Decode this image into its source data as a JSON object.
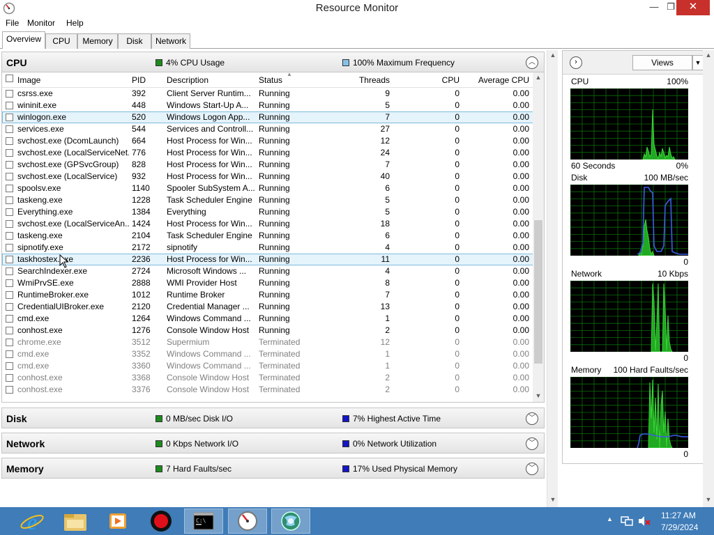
{
  "window": {
    "title": "Resource Monitor",
    "min_glyph": "—",
    "max_glyph": "❐",
    "close_glyph": "✕"
  },
  "menu": [
    "File",
    "Monitor",
    "Help"
  ],
  "tabs": [
    "Overview",
    "CPU",
    "Memory",
    "Disk",
    "Network"
  ],
  "active_tab": "Overview",
  "cpu_section": {
    "title": "CPU",
    "stat1": "4% CPU Usage",
    "stat1_color": "#1e8a1e",
    "stat2": "100% Maximum Frequency",
    "stat2_color": "#86c1ea",
    "columns": [
      "Image",
      "PID",
      "Description",
      "Status",
      "Threads",
      "CPU",
      "Average CPU"
    ],
    "rows": [
      {
        "image": "csrss.exe",
        "pid": "392",
        "desc": "Client Server Runtim...",
        "status": "Running",
        "threads": "9",
        "cpu": "0",
        "avg": "0.00"
      },
      {
        "image": "wininit.exe",
        "pid": "448",
        "desc": "Windows Start-Up A...",
        "status": "Running",
        "threads": "5",
        "cpu": "0",
        "avg": "0.00"
      },
      {
        "image": "winlogon.exe",
        "pid": "520",
        "desc": "Windows Logon App...",
        "status": "Running",
        "threads": "7",
        "cpu": "0",
        "avg": "0.00",
        "selected": true
      },
      {
        "image": "services.exe",
        "pid": "544",
        "desc": "Services and Controll...",
        "status": "Running",
        "threads": "27",
        "cpu": "0",
        "avg": "0.00"
      },
      {
        "image": "svchost.exe (DcomLaunch)",
        "pid": "664",
        "desc": "Host Process for Win...",
        "status": "Running",
        "threads": "12",
        "cpu": "0",
        "avg": "0.00"
      },
      {
        "image": "svchost.exe (LocalServiceNet...",
        "pid": "776",
        "desc": "Host Process for Win...",
        "status": "Running",
        "threads": "24",
        "cpu": "0",
        "avg": "0.00"
      },
      {
        "image": "svchost.exe (GPSvcGroup)",
        "pid": "828",
        "desc": "Host Process for Win...",
        "status": "Running",
        "threads": "7",
        "cpu": "0",
        "avg": "0.00"
      },
      {
        "image": "svchost.exe (LocalService)",
        "pid": "932",
        "desc": "Host Process for Win...",
        "status": "Running",
        "threads": "40",
        "cpu": "0",
        "avg": "0.00"
      },
      {
        "image": "spoolsv.exe",
        "pid": "1140",
        "desc": "Spooler SubSystem A...",
        "status": "Running",
        "threads": "6",
        "cpu": "0",
        "avg": "0.00"
      },
      {
        "image": "taskeng.exe",
        "pid": "1228",
        "desc": "Task Scheduler Engine",
        "status": "Running",
        "threads": "5",
        "cpu": "0",
        "avg": "0.00"
      },
      {
        "image": "Everything.exe",
        "pid": "1384",
        "desc": "Everything",
        "status": "Running",
        "threads": "5",
        "cpu": "0",
        "avg": "0.00"
      },
      {
        "image": "svchost.exe (LocalServiceAn...",
        "pid": "1424",
        "desc": "Host Process for Win...",
        "status": "Running",
        "threads": "18",
        "cpu": "0",
        "avg": "0.00"
      },
      {
        "image": "taskeng.exe",
        "pid": "2104",
        "desc": "Task Scheduler Engine",
        "status": "Running",
        "threads": "6",
        "cpu": "0",
        "avg": "0.00"
      },
      {
        "image": "sipnotify.exe",
        "pid": "2172",
        "desc": "sipnotify",
        "status": "Running",
        "threads": "4",
        "cpu": "0",
        "avg": "0.00"
      },
      {
        "image": "taskhostex.exe",
        "pid": "2236",
        "desc": "Host Process for Win...",
        "status": "Running",
        "threads": "11",
        "cpu": "0",
        "avg": "0.00",
        "hover": true
      },
      {
        "image": "SearchIndexer.exe",
        "pid": "2724",
        "desc": "Microsoft Windows ...",
        "status": "Running",
        "threads": "4",
        "cpu": "0",
        "avg": "0.00"
      },
      {
        "image": "WmiPrvSE.exe",
        "pid": "2888",
        "desc": "WMI Provider Host",
        "status": "Running",
        "threads": "8",
        "cpu": "0",
        "avg": "0.00"
      },
      {
        "image": "RuntimeBroker.exe",
        "pid": "1012",
        "desc": "Runtime Broker",
        "status": "Running",
        "threads": "7",
        "cpu": "0",
        "avg": "0.00"
      },
      {
        "image": "CredentialUIBroker.exe",
        "pid": "2120",
        "desc": "Credential Manager ...",
        "status": "Running",
        "threads": "13",
        "cpu": "0",
        "avg": "0.00"
      },
      {
        "image": "cmd.exe",
        "pid": "1264",
        "desc": "Windows Command ...",
        "status": "Running",
        "threads": "1",
        "cpu": "0",
        "avg": "0.00"
      },
      {
        "image": "conhost.exe",
        "pid": "1276",
        "desc": "Console Window Host",
        "status": "Running",
        "threads": "2",
        "cpu": "0",
        "avg": "0.00"
      },
      {
        "image": "chrome.exe",
        "pid": "3512",
        "desc": "Supermium",
        "status": "Terminated",
        "threads": "12",
        "cpu": "0",
        "avg": "0.00"
      },
      {
        "image": "cmd.exe",
        "pid": "3352",
        "desc": "Windows Command ...",
        "status": "Terminated",
        "threads": "1",
        "cpu": "0",
        "avg": "0.00"
      },
      {
        "image": "cmd.exe",
        "pid": "3360",
        "desc": "Windows Command ...",
        "status": "Terminated",
        "threads": "1",
        "cpu": "0",
        "avg": "0.00"
      },
      {
        "image": "conhost.exe",
        "pid": "3368",
        "desc": "Console Window Host",
        "status": "Terminated",
        "threads": "2",
        "cpu": "0",
        "avg": "0.00"
      },
      {
        "image": "conhost.exe",
        "pid": "3376",
        "desc": "Console Window Host",
        "status": "Terminated",
        "threads": "2",
        "cpu": "0",
        "avg": "0.00"
      }
    ]
  },
  "collapsed_sections": [
    {
      "key": "disk",
      "title": "Disk",
      "stat1": "0 MB/sec Disk I/O",
      "stat2": "7% Highest Active Time"
    },
    {
      "key": "network",
      "title": "Network",
      "stat1": "0 Kbps Network I/O",
      "stat2": "0% Network Utilization"
    },
    {
      "key": "memory",
      "title": "Memory",
      "stat1": "7 Hard Faults/sec",
      "stat2": "17% Used Physical Memory"
    }
  ],
  "collapsed_stat1_color": "#1e8a1e",
  "collapsed_stat2_color": "#1414c8",
  "right_panel": {
    "views_label": "Views",
    "graphs": [
      {
        "name": "CPU",
        "max": "100%",
        "bottom_left": "60 Seconds",
        "bottom_right": "0%"
      },
      {
        "name": "Disk",
        "max": "100 MB/sec",
        "bottom_left": "",
        "bottom_right": "0"
      },
      {
        "name": "Network",
        "max": "10 Kbps",
        "bottom_left": "",
        "bottom_right": "0"
      },
      {
        "name": "Memory",
        "max": "100 Hard Faults/sec",
        "bottom_left": "",
        "bottom_right": "0"
      }
    ]
  },
  "taskbar": {
    "apps": [
      "internet-explorer",
      "file-explorer",
      "media-player",
      "record",
      "command-prompt",
      "resource-monitor",
      "network-globe"
    ],
    "time": "11:27 AM",
    "date": "7/29/2024"
  }
}
